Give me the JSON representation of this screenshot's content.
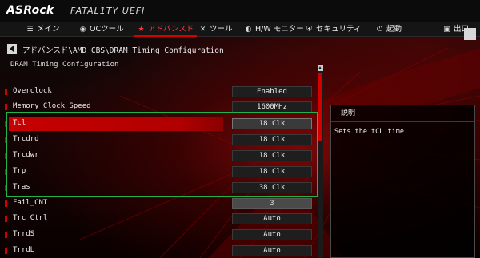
{
  "topbar": {
    "brand": "ASRock",
    "product": "FATAL1TY UEFI"
  },
  "tabs": [
    {
      "icon": "list-icon",
      "glyph": "☰",
      "label": "メイン",
      "active": false
    },
    {
      "icon": "oc-icon",
      "glyph": "◉",
      "label": "OCツール",
      "active": false
    },
    {
      "icon": "star-icon",
      "glyph": "★",
      "label": "アドバンスド",
      "active": true
    },
    {
      "icon": "tools-icon",
      "glyph": "✕",
      "label": "ツール",
      "active": false
    },
    {
      "icon": "monitor-icon",
      "glyph": "◐",
      "label": "H/W モニター",
      "active": false
    },
    {
      "icon": "shield-icon",
      "glyph": "⛨",
      "label": "セキュリティ",
      "active": false
    },
    {
      "icon": "power-icon",
      "glyph": "⏻",
      "label": "起動",
      "active": false
    },
    {
      "icon": "exit-icon",
      "glyph": "▣",
      "label": "出口",
      "active": false
    }
  ],
  "breadcrumb": "アドバンスド\\AMD CBS\\DRAM Timing Configuration",
  "subtitle": "DRAM Timing Configuration",
  "settings": [
    {
      "label": "Overclock",
      "value": "Enabled",
      "selected": false,
      "grey": false
    },
    {
      "label": "Memory Clock Speed",
      "value": "1600MHz",
      "selected": false,
      "grey": false
    },
    {
      "label": "Tcl",
      "value": "18 Clk",
      "selected": true,
      "grey": false
    },
    {
      "label": "Trcdrd",
      "value": "18 Clk",
      "selected": false,
      "grey": false
    },
    {
      "label": "Trcdwr",
      "value": "18 Clk",
      "selected": false,
      "grey": false
    },
    {
      "label": "Trp",
      "value": "18 Clk",
      "selected": false,
      "grey": false
    },
    {
      "label": "Tras",
      "value": "38 Clk",
      "selected": false,
      "grey": false
    },
    {
      "label": "Fail_CNT",
      "value": "3",
      "selected": false,
      "grey": true
    },
    {
      "label": "Trc Ctrl",
      "value": "Auto",
      "selected": false,
      "grey": false
    },
    {
      "label": "TrrdS",
      "value": "Auto",
      "selected": false,
      "grey": false
    },
    {
      "label": "TrrdL",
      "value": "Auto",
      "selected": false,
      "grey": false
    }
  ],
  "description": {
    "title": "説明",
    "text": "Sets the tCL time."
  },
  "colors": {
    "accent": "#d00000",
    "highlight": "#22b24c",
    "panel": "#151515"
  }
}
